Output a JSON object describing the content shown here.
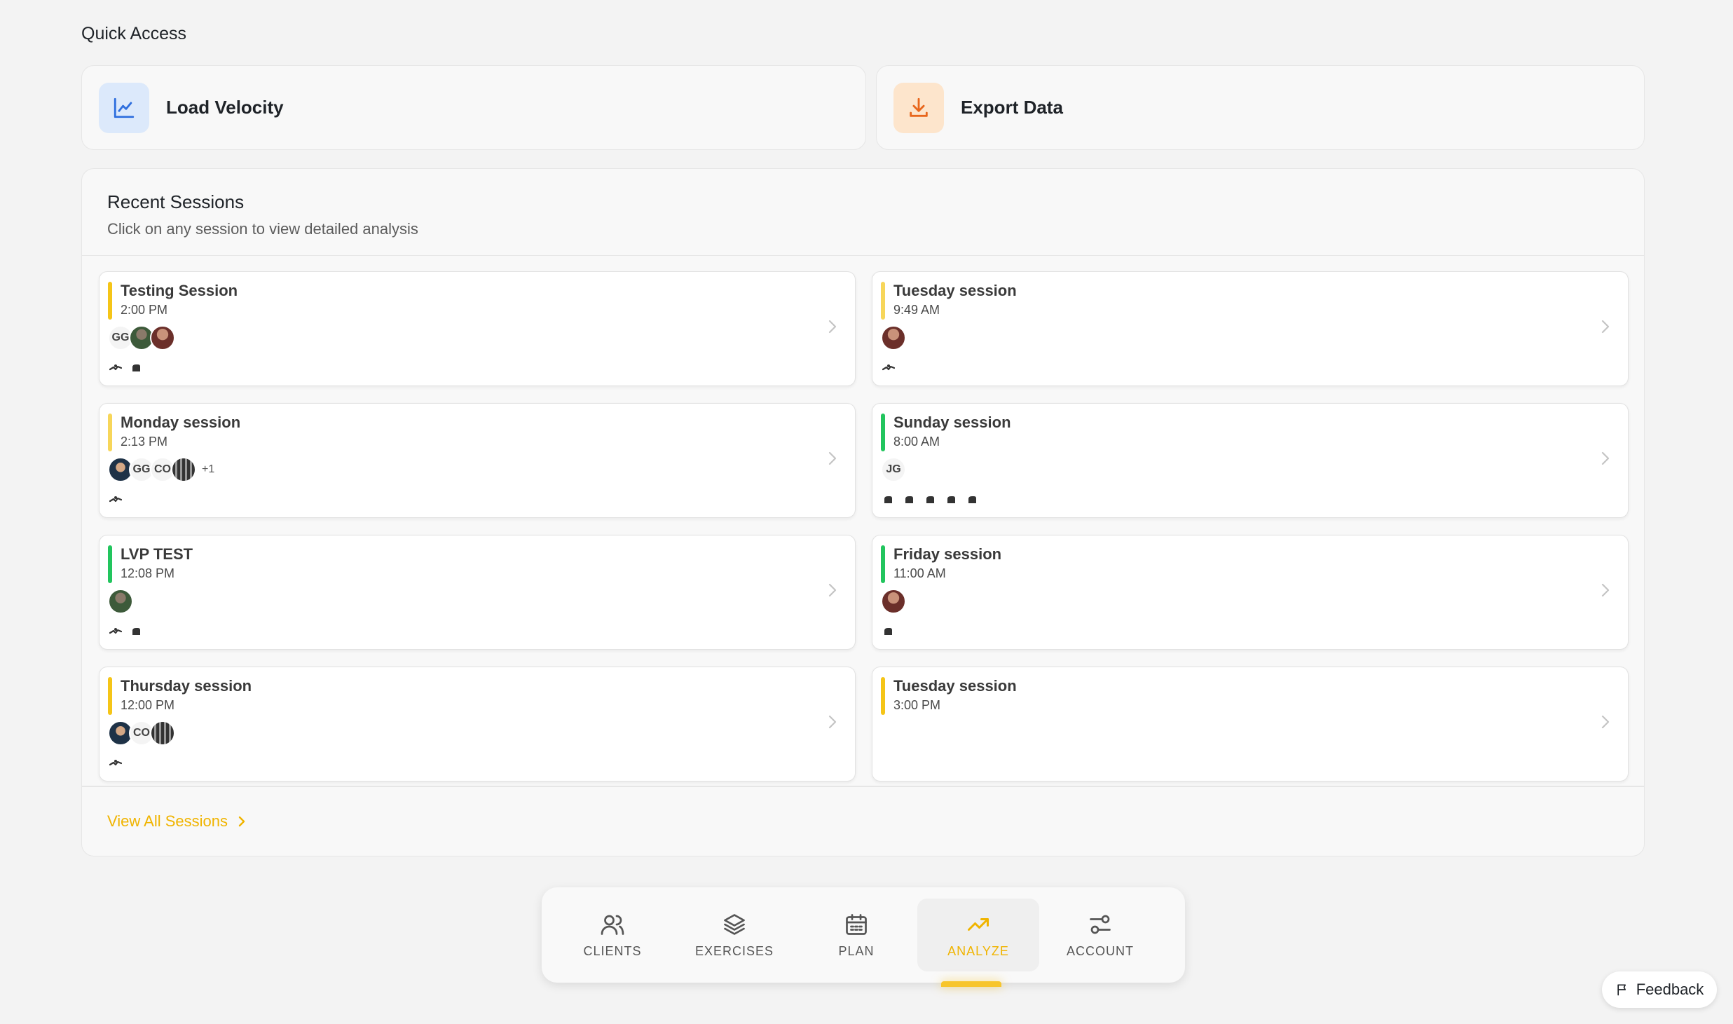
{
  "quick_access": {
    "title": "Quick Access",
    "cards": [
      {
        "label": "Load Velocity",
        "icon": "line-chart-icon",
        "color": "#2f6fde"
      },
      {
        "label": "Export Data",
        "icon": "download-icon",
        "color": "#e8661c"
      }
    ]
  },
  "recent_sessions": {
    "title": "Recent Sessions",
    "subtitle": "Click on any session to view detailed analysis",
    "view_all": "View All Sessions",
    "status_colors": {
      "pending": "#f7d65a",
      "completed": "#22c55e",
      "active": "#f5c518"
    },
    "sessions": [
      {
        "title": "Testing Session",
        "time": "2:00 PM",
        "status": "active",
        "avatars": [
          "GG",
          "",
          ""
        ],
        "extra": "",
        "exercises": [
          "squat-icon",
          "arm-icon"
        ]
      },
      {
        "title": "Tuesday session",
        "time": "9:49 AM",
        "status": "pending",
        "avatars": [
          ""
        ],
        "extra": "",
        "exercises": [
          "squat-icon"
        ]
      },
      {
        "title": "Monday session",
        "time": "2:13 PM",
        "status": "pending",
        "avatars": [
          "",
          "GG",
          "CO",
          ""
        ],
        "extra": "+1",
        "exercises": [
          "squat-icon"
        ]
      },
      {
        "title": "Sunday session",
        "time": "8:00 AM",
        "status": "completed",
        "avatars": [
          "JG"
        ],
        "extra": "",
        "exercises": [
          "arm-icon",
          "arm-icon",
          "arm-icon",
          "arm-icon",
          "arm-icon"
        ]
      },
      {
        "title": "LVP TEST",
        "time": "12:08 PM",
        "status": "completed",
        "avatars": [
          ""
        ],
        "extra": "",
        "exercises": [
          "squat-icon",
          "arm-icon"
        ]
      },
      {
        "title": "Friday session",
        "time": "11:00 AM",
        "status": "completed",
        "avatars": [
          ""
        ],
        "extra": "",
        "exercises": [
          "arm-icon"
        ]
      },
      {
        "title": "Thursday session",
        "time": "12:00 PM",
        "status": "active",
        "avatars": [
          "",
          "CO",
          ""
        ],
        "extra": "",
        "exercises": [
          "squat-icon"
        ]
      },
      {
        "title": "Tuesday session",
        "time": "3:00 PM",
        "status": "active",
        "avatars": [],
        "extra": "",
        "exercises": []
      }
    ]
  },
  "nav": {
    "items": [
      {
        "label": "CLIENTS",
        "icon": "users-icon"
      },
      {
        "label": "EXERCISES",
        "icon": "layers-icon"
      },
      {
        "label": "PLAN",
        "icon": "calendar-icon"
      },
      {
        "label": "ANALYZE",
        "icon": "trending-up-icon"
      },
      {
        "label": "ACCOUNT",
        "icon": "sliders-icon"
      }
    ],
    "active": "ANALYZE"
  },
  "feedback": {
    "label": "Feedback",
    "icon": "flag-icon"
  }
}
